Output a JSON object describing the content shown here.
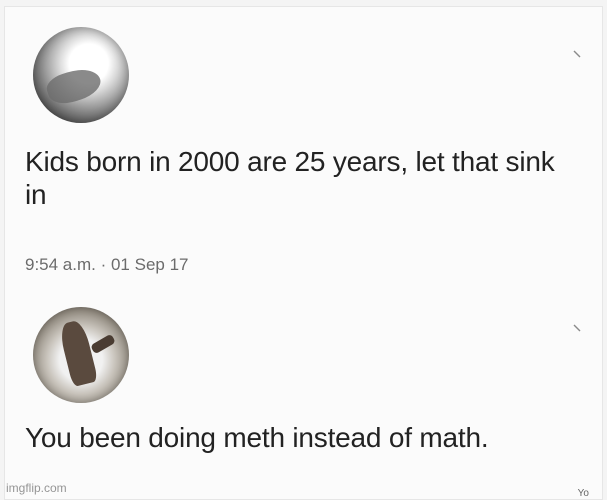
{
  "posts": [
    {
      "text": "Kids born in 2000 are 25 years, let that sink in",
      "timestamp": "9:54 a.m. · 01 Sep 17",
      "avatar_icon": "user-avatar",
      "menu_icon": "chevron-down-icon"
    },
    {
      "text": "You been doing meth instead of math.",
      "avatar_icon": "user-avatar",
      "menu_icon": "chevron-down-icon"
    }
  ],
  "watermark": "imgflip.com",
  "corner_mark": "Yo"
}
